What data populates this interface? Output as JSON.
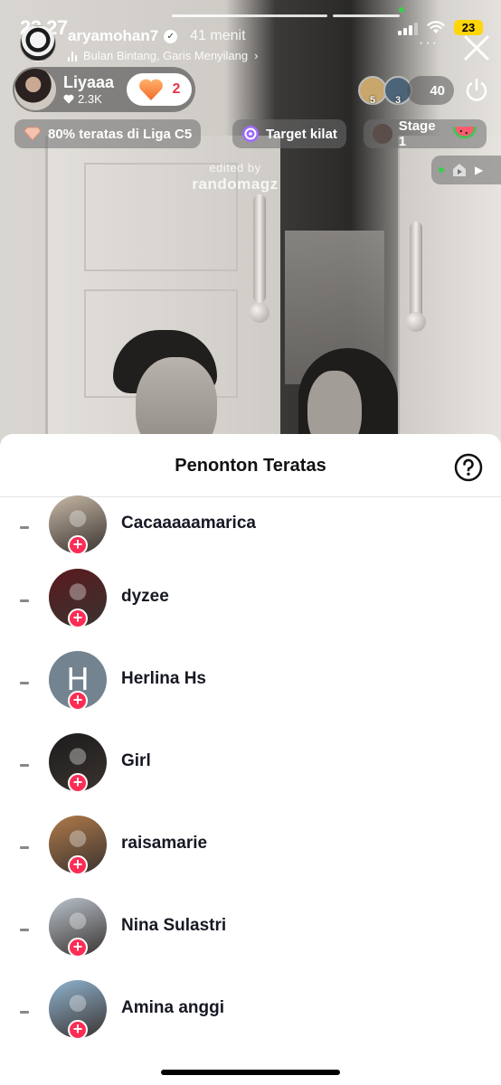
{
  "status_bar": {
    "time": "23.27",
    "battery": "23"
  },
  "host": {
    "username": "aryamohan7",
    "time_ago": "41 menit",
    "music": "Bulan Bintang, Garis Menyilang",
    "verified": true
  },
  "creator": {
    "name": "Liyaaa",
    "likes": "2.3K",
    "hearts": "2"
  },
  "viewers": {
    "top": [
      {
        "rank": "5",
        "color": "#c9a66b"
      },
      {
        "rank": "3",
        "color": "#4b6478"
      }
    ],
    "count": "40"
  },
  "chips": {
    "league": "80% teratas di Liga C5",
    "target": "Target kilat",
    "stage": "Stage 1"
  },
  "watermark": {
    "line1": "edited by",
    "line2": "randomagz"
  },
  "sheet": {
    "title": "Penonton Teratas",
    "viewers": [
      {
        "rank": "-",
        "name": "Cacaaaaamarica",
        "avatar_color": "#c7b9a6",
        "initial": ""
      },
      {
        "rank": "-",
        "name": "dyzee",
        "avatar_color": "#5a1a1e",
        "initial": ""
      },
      {
        "rank": "-",
        "name": "Herlina Hs",
        "avatar_color": "#73838f",
        "initial": "H"
      },
      {
        "rank": "-",
        "name": "Girl",
        "avatar_color": "#1c1c1c",
        "initial": ""
      },
      {
        "rank": "-",
        "name": "raisamarie",
        "avatar_color": "#b07a4a",
        "initial": ""
      },
      {
        "rank": "-",
        "name": "Nina Sulastri",
        "avatar_color": "#b9c3cc",
        "initial": ""
      },
      {
        "rank": "-",
        "name": "Amina anggi",
        "avatar_color": "#8fb3cf",
        "initial": ""
      }
    ]
  },
  "colors": {
    "follow_badge": "#fe2c55",
    "heart_count": "#e8344a",
    "battery": "#ffd60a"
  }
}
